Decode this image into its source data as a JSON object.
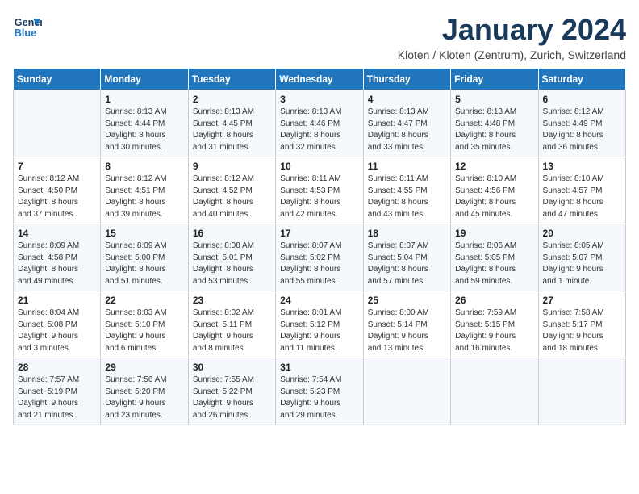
{
  "logo": {
    "line1": "General",
    "line2": "Blue"
  },
  "title": "January 2024",
  "location": "Kloten / Kloten (Zentrum), Zurich, Switzerland",
  "headers": [
    "Sunday",
    "Monday",
    "Tuesday",
    "Wednesday",
    "Thursday",
    "Friday",
    "Saturday"
  ],
  "weeks": [
    [
      {
        "day": "",
        "info": ""
      },
      {
        "day": "1",
        "info": "Sunrise: 8:13 AM\nSunset: 4:44 PM\nDaylight: 8 hours\nand 30 minutes."
      },
      {
        "day": "2",
        "info": "Sunrise: 8:13 AM\nSunset: 4:45 PM\nDaylight: 8 hours\nand 31 minutes."
      },
      {
        "day": "3",
        "info": "Sunrise: 8:13 AM\nSunset: 4:46 PM\nDaylight: 8 hours\nand 32 minutes."
      },
      {
        "day": "4",
        "info": "Sunrise: 8:13 AM\nSunset: 4:47 PM\nDaylight: 8 hours\nand 33 minutes."
      },
      {
        "day": "5",
        "info": "Sunrise: 8:13 AM\nSunset: 4:48 PM\nDaylight: 8 hours\nand 35 minutes."
      },
      {
        "day": "6",
        "info": "Sunrise: 8:12 AM\nSunset: 4:49 PM\nDaylight: 8 hours\nand 36 minutes."
      }
    ],
    [
      {
        "day": "7",
        "info": "Sunrise: 8:12 AM\nSunset: 4:50 PM\nDaylight: 8 hours\nand 37 minutes."
      },
      {
        "day": "8",
        "info": "Sunrise: 8:12 AM\nSunset: 4:51 PM\nDaylight: 8 hours\nand 39 minutes."
      },
      {
        "day": "9",
        "info": "Sunrise: 8:12 AM\nSunset: 4:52 PM\nDaylight: 8 hours\nand 40 minutes."
      },
      {
        "day": "10",
        "info": "Sunrise: 8:11 AM\nSunset: 4:53 PM\nDaylight: 8 hours\nand 42 minutes."
      },
      {
        "day": "11",
        "info": "Sunrise: 8:11 AM\nSunset: 4:55 PM\nDaylight: 8 hours\nand 43 minutes."
      },
      {
        "day": "12",
        "info": "Sunrise: 8:10 AM\nSunset: 4:56 PM\nDaylight: 8 hours\nand 45 minutes."
      },
      {
        "day": "13",
        "info": "Sunrise: 8:10 AM\nSunset: 4:57 PM\nDaylight: 8 hours\nand 47 minutes."
      }
    ],
    [
      {
        "day": "14",
        "info": "Sunrise: 8:09 AM\nSunset: 4:58 PM\nDaylight: 8 hours\nand 49 minutes."
      },
      {
        "day": "15",
        "info": "Sunrise: 8:09 AM\nSunset: 5:00 PM\nDaylight: 8 hours\nand 51 minutes."
      },
      {
        "day": "16",
        "info": "Sunrise: 8:08 AM\nSunset: 5:01 PM\nDaylight: 8 hours\nand 53 minutes."
      },
      {
        "day": "17",
        "info": "Sunrise: 8:07 AM\nSunset: 5:02 PM\nDaylight: 8 hours\nand 55 minutes."
      },
      {
        "day": "18",
        "info": "Sunrise: 8:07 AM\nSunset: 5:04 PM\nDaylight: 8 hours\nand 57 minutes."
      },
      {
        "day": "19",
        "info": "Sunrise: 8:06 AM\nSunset: 5:05 PM\nDaylight: 8 hours\nand 59 minutes."
      },
      {
        "day": "20",
        "info": "Sunrise: 8:05 AM\nSunset: 5:07 PM\nDaylight: 9 hours\nand 1 minute."
      }
    ],
    [
      {
        "day": "21",
        "info": "Sunrise: 8:04 AM\nSunset: 5:08 PM\nDaylight: 9 hours\nand 3 minutes."
      },
      {
        "day": "22",
        "info": "Sunrise: 8:03 AM\nSunset: 5:10 PM\nDaylight: 9 hours\nand 6 minutes."
      },
      {
        "day": "23",
        "info": "Sunrise: 8:02 AM\nSunset: 5:11 PM\nDaylight: 9 hours\nand 8 minutes."
      },
      {
        "day": "24",
        "info": "Sunrise: 8:01 AM\nSunset: 5:12 PM\nDaylight: 9 hours\nand 11 minutes."
      },
      {
        "day": "25",
        "info": "Sunrise: 8:00 AM\nSunset: 5:14 PM\nDaylight: 9 hours\nand 13 minutes."
      },
      {
        "day": "26",
        "info": "Sunrise: 7:59 AM\nSunset: 5:15 PM\nDaylight: 9 hours\nand 16 minutes."
      },
      {
        "day": "27",
        "info": "Sunrise: 7:58 AM\nSunset: 5:17 PM\nDaylight: 9 hours\nand 18 minutes."
      }
    ],
    [
      {
        "day": "28",
        "info": "Sunrise: 7:57 AM\nSunset: 5:19 PM\nDaylight: 9 hours\nand 21 minutes."
      },
      {
        "day": "29",
        "info": "Sunrise: 7:56 AM\nSunset: 5:20 PM\nDaylight: 9 hours\nand 23 minutes."
      },
      {
        "day": "30",
        "info": "Sunrise: 7:55 AM\nSunset: 5:22 PM\nDaylight: 9 hours\nand 26 minutes."
      },
      {
        "day": "31",
        "info": "Sunrise: 7:54 AM\nSunset: 5:23 PM\nDaylight: 9 hours\nand 29 minutes."
      },
      {
        "day": "",
        "info": ""
      },
      {
        "day": "",
        "info": ""
      },
      {
        "day": "",
        "info": ""
      }
    ]
  ]
}
